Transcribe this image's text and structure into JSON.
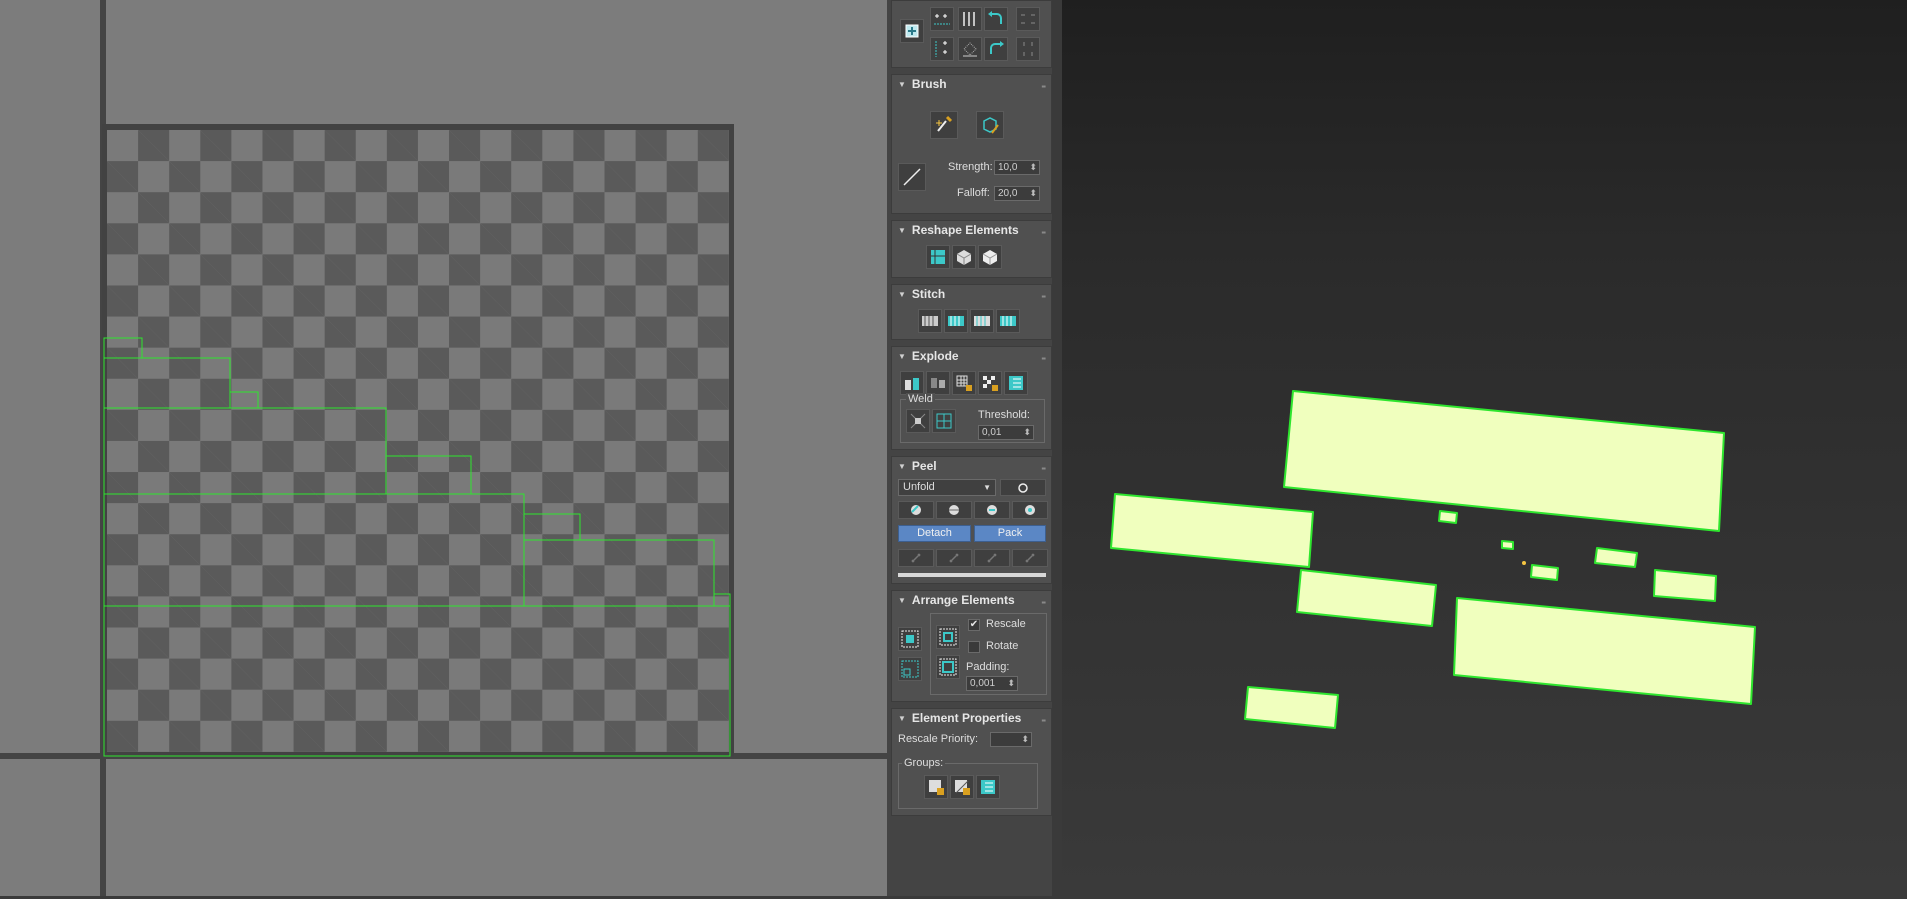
{
  "brush": {
    "title": "Brush",
    "strength_label": "Strength:",
    "strength_value": "10,0",
    "falloff_label": "Falloff:",
    "falloff_value": "20,0"
  },
  "reshape": {
    "title": "Reshape Elements"
  },
  "stitch": {
    "title": "Stitch"
  },
  "explode": {
    "title": "Explode",
    "weld_label": "Weld",
    "threshold_label": "Threshold:",
    "threshold_value": "0,01"
  },
  "peel": {
    "title": "Peel",
    "mode_value": "Unfold",
    "detach_label": "Detach",
    "pack_label": "Pack"
  },
  "arrange": {
    "title": "Arrange Elements",
    "rescale_label": "Rescale",
    "rescale_checked": true,
    "rotate_label": "Rotate",
    "rotate_checked": false,
    "padding_label": "Padding:",
    "padding_value": "0,001"
  },
  "element_properties": {
    "title": "Element Properties",
    "rescale_priority_label": "Rescale Priority:",
    "rescale_priority_value": "",
    "groups_label": "Groups:"
  },
  "colors": {
    "accent_blue": "#5b87c5",
    "uv_edge_green": "#2ee62e",
    "selected_face_fill": "#f0ffbe",
    "icon_teal": "#3cc8c8"
  }
}
